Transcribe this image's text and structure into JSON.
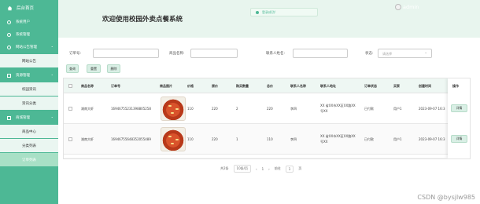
{
  "sidebar": {
    "home": "后台首页",
    "items": [
      {
        "label": "系统用户"
      },
      {
        "label": "系统管理"
      },
      {
        "label": "网站公告管理"
      }
    ],
    "sub_notice": "网站公告",
    "shop_group": "资源管理",
    "shop_subs": [
      "校园资讯",
      "资讯分类"
    ],
    "order_group": "商城管理",
    "order_subs": [
      "商品中心",
      "分类列表",
      "订单列表"
    ]
  },
  "header": {
    "title": "欢迎使用校园外卖点餐系统",
    "toast": "登录成功!",
    "user": "admin"
  },
  "filters": {
    "order_no_label": "订单号:",
    "product_label": "商品名称:",
    "contact_label": "联系人姓名:",
    "status_label": "状态:",
    "status_placeholder": "请选择"
  },
  "buttons": {
    "search": "查询",
    "reset": "重置",
    "delete": "删除"
  },
  "table": {
    "columns": [
      "商品名称",
      "订单号",
      "商品图片",
      "价格",
      "原价",
      "购买数量",
      "总价",
      "联系人名称",
      "联系人地址",
      "订单状态",
      "买家",
      "创建时间",
      "操作"
    ],
    "sort_arrows": "⇕",
    "rows": [
      {
        "name": "湖南大虾",
        "order_no": "16946755231398805258",
        "price": "110",
        "orig": "220",
        "qty": "2",
        "total": "220",
        "contact": "李四",
        "addr_1": "XX 省XX市XX区XX路XX",
        "addr_2": "号XX",
        "status": "已付款",
        "buyer": "用户1",
        "created": "2023-09-07 16:3"
      },
      {
        "name": "湖南大虾",
        "order_no": "16946755648352055489",
        "price": "110",
        "orig": "220",
        "qty": "1",
        "total": "110",
        "contact": "李四",
        "addr_1": "XX 省XX市XX区XX路XX",
        "addr_2": "号XX",
        "status": "已付款",
        "buyer": "用户1",
        "created": "2023-09-07 16:3"
      }
    ],
    "action": "详情"
  },
  "pager": {
    "total": "共2条",
    "size": "10条/页",
    "prev": "‹",
    "page": "1",
    "next": "›",
    "goto": "前往",
    "page_input": "1",
    "unit": "页"
  },
  "watermark": "CSDN @bysjlw985",
  "colors": {
    "sidebar": "#4db895",
    "header": "#e8f5ee",
    "accent": "#4db895"
  }
}
